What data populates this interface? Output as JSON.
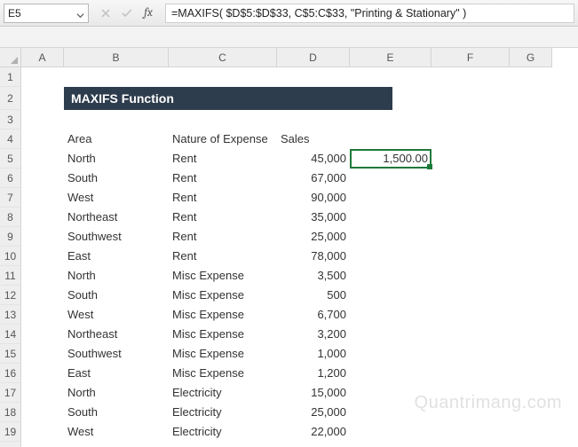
{
  "namebox": {
    "value": "E5"
  },
  "formula": "=MAXIFS( $D$5:$D$33, C$5:C$33, \"Printing & Stationary\" )",
  "columns": [
    "A",
    "B",
    "C",
    "D",
    "E",
    "F",
    "G"
  ],
  "row_numbers": [
    1,
    2,
    3,
    4,
    5,
    6,
    7,
    8,
    9,
    10,
    11,
    12,
    13,
    14,
    15,
    16,
    17,
    18,
    19
  ],
  "title": "MAXIFS Function",
  "headers": {
    "area": "Area",
    "nature": "Nature of Expense",
    "sales": "Sales"
  },
  "selected": {
    "cell": "E5",
    "value": "1,500.00"
  },
  "rows": [
    {
      "area": "North",
      "nature": "Rent",
      "sales": "45,000"
    },
    {
      "area": "South",
      "nature": "Rent",
      "sales": "67,000"
    },
    {
      "area": "West",
      "nature": "Rent",
      "sales": "90,000"
    },
    {
      "area": "Northeast",
      "nature": "Rent",
      "sales": "35,000"
    },
    {
      "area": "Southwest",
      "nature": "Rent",
      "sales": "25,000"
    },
    {
      "area": "East",
      "nature": "Rent",
      "sales": "78,000"
    },
    {
      "area": "North",
      "nature": "Misc Expense",
      "sales": "3,500"
    },
    {
      "area": "South",
      "nature": "Misc Expense",
      "sales": "500"
    },
    {
      "area": "West",
      "nature": "Misc Expense",
      "sales": "6,700"
    },
    {
      "area": "Northeast",
      "nature": "Misc Expense",
      "sales": "3,200"
    },
    {
      "area": "Southwest",
      "nature": "Misc Expense",
      "sales": "1,000"
    },
    {
      "area": "East",
      "nature": "Misc Expense",
      "sales": "1,200"
    },
    {
      "area": "North",
      "nature": "Electricity",
      "sales": "15,000"
    },
    {
      "area": "South",
      "nature": "Electricity",
      "sales": "25,000"
    },
    {
      "area": "West",
      "nature": "Electricity",
      "sales": "22,000"
    }
  ],
  "watermark": "Quantrimang.com"
}
